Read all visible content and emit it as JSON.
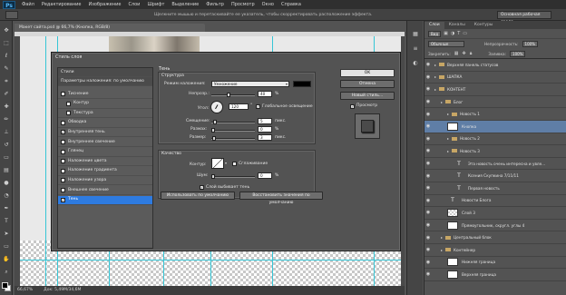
{
  "menu": {
    "logo": "Ps",
    "items": [
      "Файл",
      "Редактирование",
      "Изображение",
      "Слои",
      "Шрифт",
      "Выделение",
      "Фильтр",
      "Просмотр",
      "Окно",
      "Справка"
    ]
  },
  "options_bar": {
    "hint": "Щелкните мышью и перетаскивайте ее указатель, чтобы скорректировать расположение эффекта.",
    "workspace": "Основная рабочая среда"
  },
  "document": {
    "tab_title": "Макет сайта.psd @ 66,7% (Кнопка, RGB/8)",
    "zoom": "66,67%",
    "doc_size": "Док: 5,49M/34,6M"
  },
  "dialog": {
    "title": "Стиль слоя",
    "styles_header": "Стили",
    "blend_options": "Параметры наложения: по умолчанию",
    "styles": [
      {
        "label": "Тиснение",
        "checked": false,
        "indent": false
      },
      {
        "label": "Контур",
        "checked": false,
        "indent": true
      },
      {
        "label": "Текстура",
        "checked": false,
        "indent": true
      },
      {
        "label": "Обводка",
        "checked": false,
        "indent": false
      },
      {
        "label": "Внутренняя тень",
        "checked": true,
        "indent": false
      },
      {
        "label": "Внутреннее свечение",
        "checked": false,
        "indent": false
      },
      {
        "label": "Глянец",
        "checked": false,
        "indent": false
      },
      {
        "label": "Наложение цвета",
        "checked": false,
        "indent": false
      },
      {
        "label": "Наложение градиента",
        "checked": false,
        "indent": false
      },
      {
        "label": "Наложение узора",
        "checked": false,
        "indent": false
      },
      {
        "label": "Внешнее свечение",
        "checked": false,
        "indent": false
      },
      {
        "label": "Тень",
        "checked": true,
        "indent": false,
        "selected": true
      }
    ],
    "section_title": "Тень",
    "structure_title": "Структура",
    "blend_mode_label": "Режим наложения:",
    "blend_mode_value": "Умножение",
    "opacity_label": "Непрозр.:",
    "opacity_value": "40",
    "angle_label": "Угол:",
    "angle_value": "120",
    "global_light": "Глобальное освещение",
    "distance_label": "Смещение:",
    "distance_value": "5",
    "spread_label": "Размах:",
    "spread_value": "0",
    "size_label": "Размер:",
    "size_value": "3",
    "unit_px": "пикс.",
    "unit_pct": "%",
    "degree": "°",
    "quality_title": "Качество",
    "contour_label": "Контур:",
    "antialias": "Сглаживание",
    "noise_label": "Шум:",
    "noise_value": "0",
    "knockout": "Слой выбивает тень",
    "btn_make_default": "Использовать по умолчанию",
    "btn_reset_default": "Восстановить значения по умолчанию",
    "btn_ok": "OK",
    "btn_cancel": "Отмена",
    "btn_new_style": "Новый стиль...",
    "preview_label": "Просмотр",
    "shadow_color": "#000000"
  },
  "layers_panel": {
    "tabs": [
      "Слои",
      "Каналы",
      "Контуры"
    ],
    "filter_kind": "Вид",
    "blend_mode": "Обычные",
    "opacity_label": "Непрозрачность:",
    "opacity_value": "100%",
    "lock_label": "Закрепить:",
    "fill_label": "Заливка:",
    "fill_value": "100%",
    "rows": [
      {
        "name": "Верхняя панель статусов",
        "kind": "folder",
        "indent": 0
      },
      {
        "name": "ШАПКА",
        "kind": "folder",
        "indent": 0
      },
      {
        "name": "КОНТЕНТ",
        "kind": "folder",
        "indent": 0
      },
      {
        "name": "Блог",
        "kind": "folder",
        "indent": 1
      },
      {
        "name": "Новость 1",
        "kind": "folder",
        "indent": 2
      },
      {
        "name": "Кнопка",
        "kind": "thumb",
        "indent": 2,
        "selected": true
      },
      {
        "name": "Новость 2",
        "kind": "folder",
        "indent": 2
      },
      {
        "name": "Новость 3",
        "kind": "folder",
        "indent": 2
      },
      {
        "name": "Эта новость очень интересна и увле...",
        "kind": "text",
        "indent": 3
      },
      {
        "name": "Ксения Скупкина  7/11/11",
        "kind": "text",
        "indent": 3
      },
      {
        "name": "Первая новость",
        "kind": "text",
        "indent": 3
      },
      {
        "name": "Новости Блога",
        "kind": "text",
        "indent": 2
      },
      {
        "name": "Слой 3",
        "kind": "thumb-check",
        "indent": 2
      },
      {
        "name": "Прямоугольник, скругл. углы 4",
        "kind": "thumb",
        "indent": 2
      },
      {
        "name": "Центральный блок",
        "kind": "folder",
        "indent": 1
      },
      {
        "name": "Контейнер",
        "kind": "folder",
        "indent": 1
      },
      {
        "name": "Нижняя граница",
        "kind": "thumb",
        "indent": 2
      },
      {
        "name": "Верхняя граница",
        "kind": "thumb",
        "indent": 2
      }
    ]
  }
}
